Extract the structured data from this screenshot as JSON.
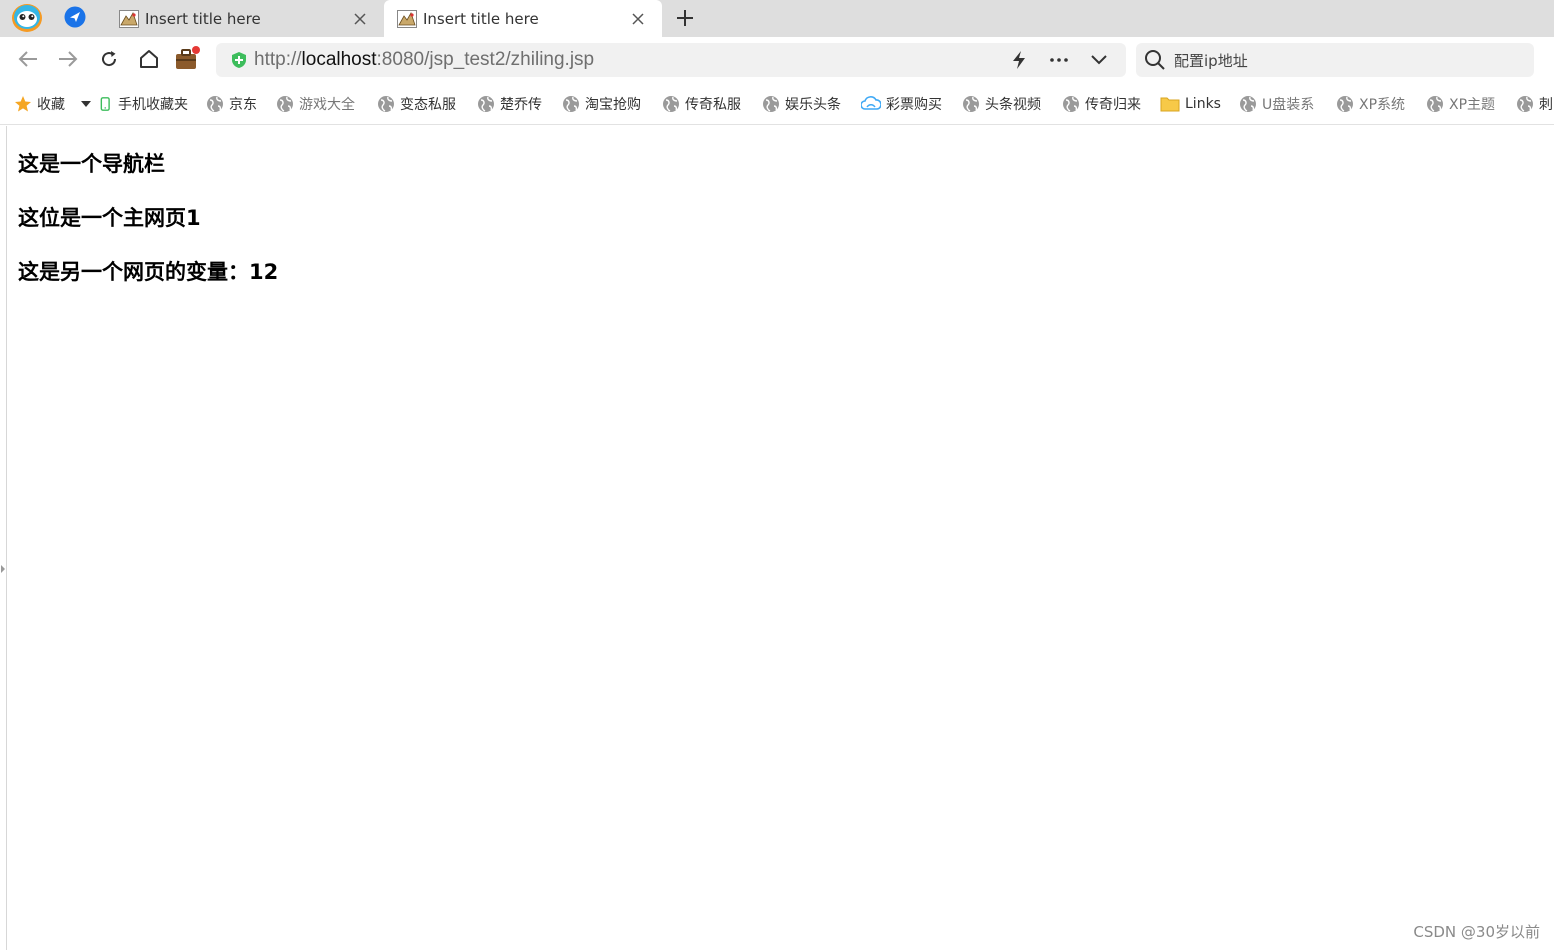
{
  "tabs": [
    {
      "label": "Insert title here",
      "active": false
    },
    {
      "label": "Insert title here",
      "active": true
    }
  ],
  "address_bar": {
    "scheme": "http://",
    "host": "localhost",
    "path": ":8080/jsp_test2/zhiling.jsp"
  },
  "search": {
    "placeholder": "配置ip地址"
  },
  "bookmarks": {
    "favorites_label": "收藏",
    "items": [
      {
        "label": "手机收藏夹",
        "icon": "phone-icon"
      },
      {
        "label": "京东",
        "icon": "globe-icon"
      },
      {
        "label": "游戏大全",
        "icon": "globe-icon"
      },
      {
        "label": "变态私服",
        "icon": "globe-icon"
      },
      {
        "label": "楚乔传",
        "icon": "globe-icon"
      },
      {
        "label": "淘宝抢购",
        "icon": "globe-icon"
      },
      {
        "label": "传奇私服",
        "icon": "globe-icon"
      },
      {
        "label": "娱乐头条",
        "icon": "globe-icon"
      },
      {
        "label": "彩票购买",
        "icon": "cloud-icon"
      },
      {
        "label": "头条视频",
        "icon": "globe-icon"
      },
      {
        "label": "传奇归来",
        "icon": "globe-icon"
      },
      {
        "label": "Links",
        "icon": "folder-icon"
      },
      {
        "label": "U盘装系",
        "icon": "globe-icon"
      },
      {
        "label": "XP系统",
        "icon": "globe-icon"
      },
      {
        "label": "XP主题",
        "icon": "globe-icon"
      },
      {
        "label": "刺",
        "icon": "globe-icon"
      }
    ]
  },
  "page": {
    "heading1": "这是一个导航栏",
    "heading2": "这位是一个主网页1",
    "heading3": "这是另一个网页的变量：12"
  },
  "watermark": "CSDN @30岁以前",
  "colors": {
    "tabstrip_bg": "#dedede",
    "address_bg": "#f1f1f1",
    "secure_green": "#3dbd5c",
    "send_blue": "#1a73e8",
    "star_orange": "#f5a623",
    "folder_yellow": "#f7c948",
    "badge_red": "#e53935"
  }
}
